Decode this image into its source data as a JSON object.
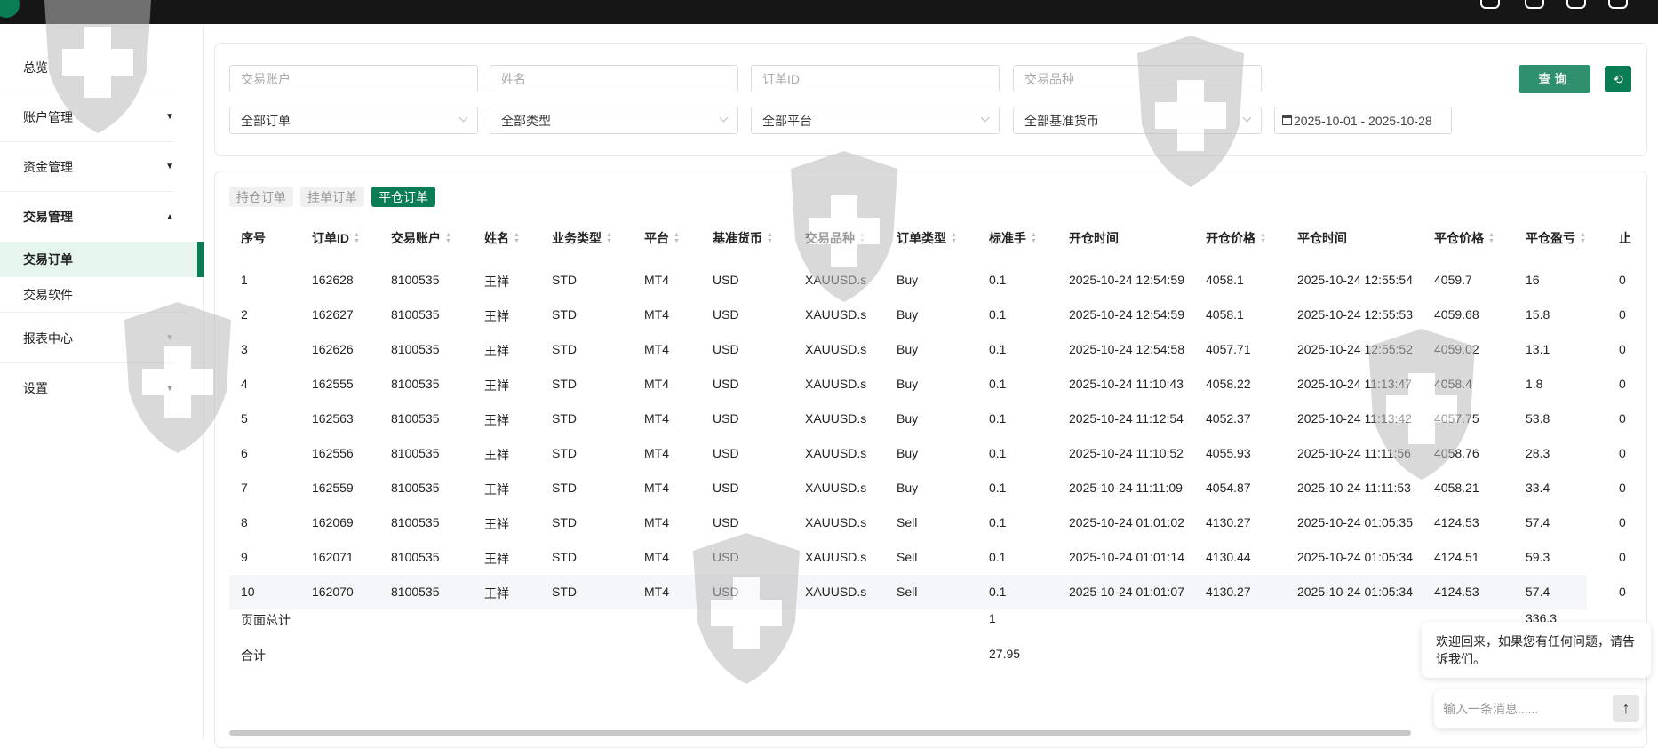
{
  "sidebar": {
    "items": [
      {
        "label": "总览",
        "caret": ""
      },
      {
        "label": "账户管理",
        "caret": "▼"
      },
      {
        "label": "资金管理",
        "caret": "▼"
      },
      {
        "label": "交易管理",
        "caret": "▲"
      },
      {
        "label": "报表中心",
        "caret": "▼"
      },
      {
        "label": "设置",
        "caret": "▼"
      }
    ],
    "sub": [
      {
        "label": "交易订单",
        "active": true
      },
      {
        "label": "交易软件",
        "active": false
      }
    ]
  },
  "filters": {
    "account_placeholder": "交易账户",
    "name_placeholder": "姓名",
    "order_id_placeholder": "订单ID",
    "symbol_placeholder": "交易品种",
    "order_select": "全部订单",
    "type_select": "全部类型",
    "platform_select": "全部平台",
    "currency_select": "全部基准货币",
    "date_range": "2025-10-01 - 2025-10-28",
    "query_label": "查询"
  },
  "tabs": [
    "持仓订单",
    "挂单订单",
    "平仓订单"
  ],
  "table": {
    "columns": [
      {
        "label": "序号",
        "sort": false
      },
      {
        "label": "订单ID",
        "sort": true
      },
      {
        "label": "交易账户",
        "sort": true
      },
      {
        "label": "姓名",
        "sort": true
      },
      {
        "label": "业务类型",
        "sort": true
      },
      {
        "label": "平台",
        "sort": true
      },
      {
        "label": "基准货币",
        "sort": true
      },
      {
        "label": "交易品种",
        "sort": true
      },
      {
        "label": "订单类型",
        "sort": true
      },
      {
        "label": "标准手",
        "sort": true
      },
      {
        "label": "开仓时间",
        "sort": false
      },
      {
        "label": "开仓价格",
        "sort": true
      },
      {
        "label": "平仓时间",
        "sort": false
      },
      {
        "label": "平仓价格",
        "sort": true
      },
      {
        "label": "平仓盈亏",
        "sort": true
      },
      {
        "label": "止",
        "sort": false
      }
    ],
    "rows": [
      [
        "1",
        "162628",
        "8100535",
        "王祥",
        "STD",
        "MT4",
        "USD",
        "XAUUSD.s",
        "Buy",
        "0.1",
        "2025-10-24 12:54:59",
        "4058.1",
        "2025-10-24 12:55:54",
        "4059.7",
        "16",
        "0"
      ],
      [
        "2",
        "162627",
        "8100535",
        "王祥",
        "STD",
        "MT4",
        "USD",
        "XAUUSD.s",
        "Buy",
        "0.1",
        "2025-10-24 12:54:59",
        "4058.1",
        "2025-10-24 12:55:53",
        "4059.68",
        "15.8",
        "0"
      ],
      [
        "3",
        "162626",
        "8100535",
        "王祥",
        "STD",
        "MT4",
        "USD",
        "XAUUSD.s",
        "Buy",
        "0.1",
        "2025-10-24 12:54:58",
        "4057.71",
        "2025-10-24 12:55:52",
        "4059.02",
        "13.1",
        "0"
      ],
      [
        "4",
        "162555",
        "8100535",
        "王祥",
        "STD",
        "MT4",
        "USD",
        "XAUUSD.s",
        "Buy",
        "0.1",
        "2025-10-24 11:10:43",
        "4058.22",
        "2025-10-24 11:13:47",
        "4058.4",
        "1.8",
        "0"
      ],
      [
        "5",
        "162563",
        "8100535",
        "王祥",
        "STD",
        "MT4",
        "USD",
        "XAUUSD.s",
        "Buy",
        "0.1",
        "2025-10-24 11:12:54",
        "4052.37",
        "2025-10-24 11:13:42",
        "4057.75",
        "53.8",
        "0"
      ],
      [
        "6",
        "162556",
        "8100535",
        "王祥",
        "STD",
        "MT4",
        "USD",
        "XAUUSD.s",
        "Buy",
        "0.1",
        "2025-10-24 11:10:52",
        "4055.93",
        "2025-10-24 11:11:56",
        "4058.76",
        "28.3",
        "0"
      ],
      [
        "7",
        "162559",
        "8100535",
        "王祥",
        "STD",
        "MT4",
        "USD",
        "XAUUSD.s",
        "Buy",
        "0.1",
        "2025-10-24 11:11:09",
        "4054.87",
        "2025-10-24 11:11:53",
        "4058.21",
        "33.4",
        "0"
      ],
      [
        "8",
        "162069",
        "8100535",
        "王祥",
        "STD",
        "MT4",
        "USD",
        "XAUUSD.s",
        "Sell",
        "0.1",
        "2025-10-24 01:01:02",
        "4130.27",
        "2025-10-24 01:05:35",
        "4124.53",
        "57.4",
        "0"
      ],
      [
        "9",
        "162071",
        "8100535",
        "王祥",
        "STD",
        "MT4",
        "USD",
        "XAUUSD.s",
        "Sell",
        "0.1",
        "2025-10-24 01:01:14",
        "4130.44",
        "2025-10-24 01:05:34",
        "4124.51",
        "59.3",
        "0"
      ],
      [
        "10",
        "162070",
        "8100535",
        "王祥",
        "STD",
        "MT4",
        "USD",
        "XAUUSD.s",
        "Sell",
        "0.1",
        "2025-10-24 01:01:07",
        "4130.27",
        "2025-10-24 01:05:34",
        "4124.53",
        "57.4",
        "0"
      ]
    ],
    "page_total": {
      "label": "页面总计",
      "lots": "1",
      "pnl": "336.3"
    },
    "grand_total": {
      "label": "合计",
      "lots": "27.95"
    }
  },
  "chat": {
    "message": "欢迎回来，如果您有任何问题，请告诉我们。",
    "placeholder": "输入一条消息......",
    "send_icon": "↑"
  },
  "colors": {
    "brand": "#0a7d55",
    "topbar": "#161616"
  }
}
